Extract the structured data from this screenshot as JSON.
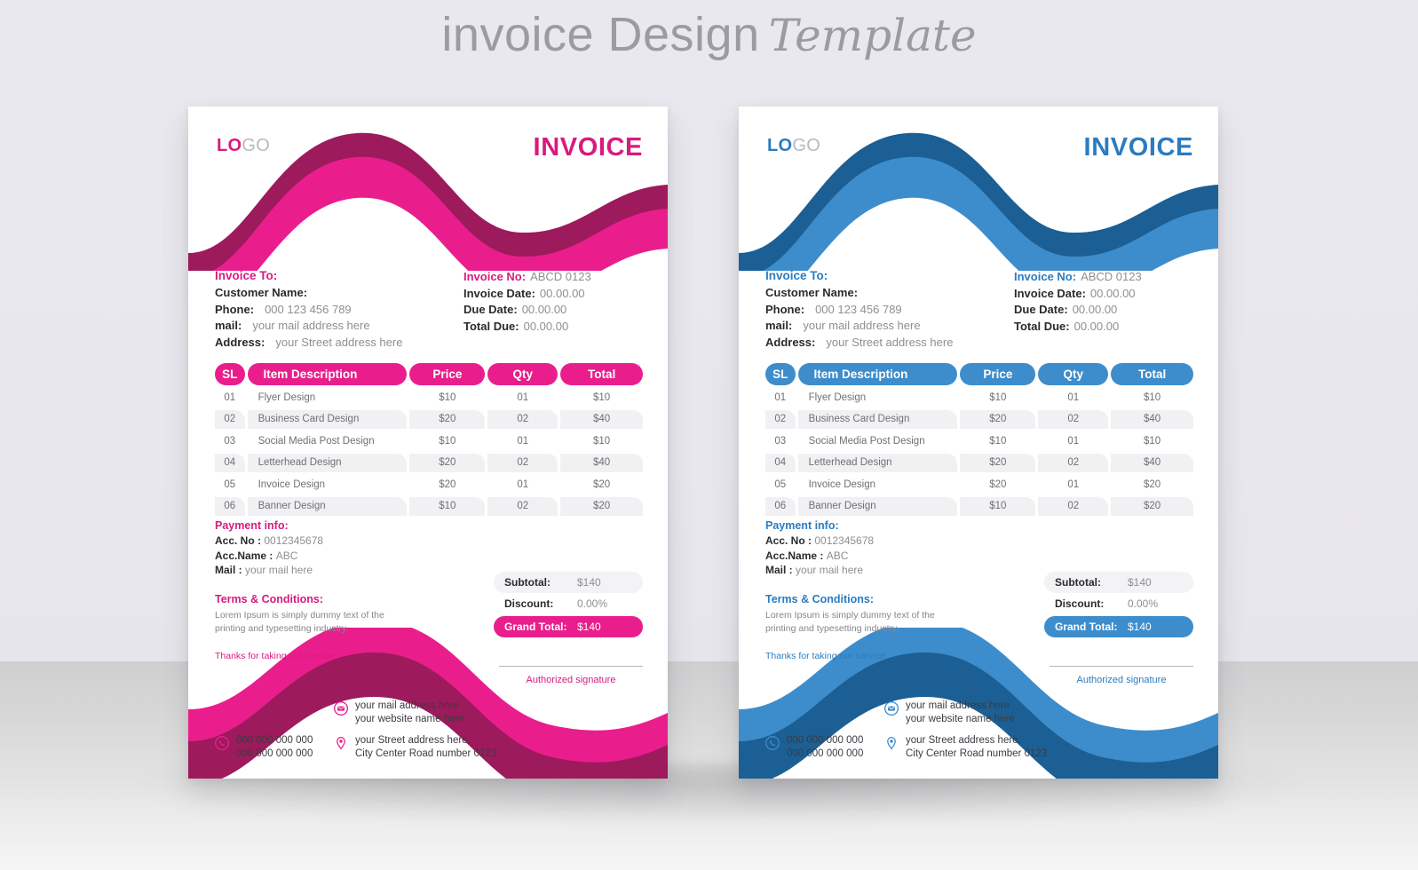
{
  "title": {
    "plain": "invoice Design",
    "script": "Template"
  },
  "theme": {
    "pink": {
      "dark": "#9d1a5c",
      "main": "#e91e8c",
      "accent": "#e91e8c",
      "title": "#d81b7e"
    },
    "blue": {
      "dark": "#1b5f94",
      "main": "#3d8dcc",
      "accent": "#3d8dcc",
      "title": "#2b7cc0"
    }
  },
  "invoice": {
    "logo": {
      "bold": "LO",
      "light": "GO"
    },
    "heading": "INVOICE",
    "bill_to": {
      "title": "Invoice To:",
      "rows": [
        {
          "label": "Customer Name:",
          "value": ""
        },
        {
          "label": "Phone:",
          "value": "000 123 456 789"
        },
        {
          "label": "mail:",
          "value": "your mail address here"
        },
        {
          "label": "Address:",
          "value": "your Street address here"
        }
      ]
    },
    "details": {
      "rows": [
        {
          "label": "Invoice No:",
          "value": "ABCD 0123"
        },
        {
          "label": "Invoice Date:",
          "value": "00.00.00"
        },
        {
          "label": "Due Date:",
          "value": "00.00.00"
        },
        {
          "label": "Total Due:",
          "value": "00.00.00"
        }
      ]
    },
    "table": {
      "columns": [
        "SL",
        "Item Description",
        "Price",
        "Qty",
        "Total"
      ],
      "rows": [
        {
          "sl": "01",
          "item": "Flyer Design",
          "price": "$10",
          "qty": "01",
          "total": "$10"
        },
        {
          "sl": "02",
          "item": "Business Card Design",
          "price": "$20",
          "qty": "02",
          "total": "$40"
        },
        {
          "sl": "03",
          "item": "Social Media Post Design",
          "price": "$10",
          "qty": "01",
          "total": "$10"
        },
        {
          "sl": "04",
          "item": "Letterhead Design",
          "price": "$20",
          "qty": "02",
          "total": "$40"
        },
        {
          "sl": "05",
          "item": "Invoice Design",
          "price": "$20",
          "qty": "01",
          "total": "$20"
        },
        {
          "sl": "06",
          "item": "Banner Design",
          "price": "$10",
          "qty": "02",
          "total": "$20"
        }
      ]
    },
    "payment": {
      "title": "Payment info:",
      "rows": [
        {
          "label": "Acc. No : ",
          "value": "0012345678"
        },
        {
          "label": "Acc.Name : ",
          "value": "ABC"
        },
        {
          "label": "Mail : ",
          "value": "your mail here"
        }
      ]
    },
    "terms": {
      "title": "Terms & Conditions:",
      "body": "Lorem Ipsum is simply dummy text of the printing and typesetting industry."
    },
    "thanks": "Thanks for taking our service",
    "totals": [
      {
        "label": "Subtotal:",
        "value": "$140"
      },
      {
        "label": "Discount:",
        "value": "0.00%"
      },
      {
        "label": "Grand Total:",
        "value": "$140"
      }
    ],
    "signature": "Authorized signature",
    "contacts": {
      "mail": {
        "line1": "your mail address here",
        "line2": "your website name here"
      },
      "phone": {
        "line1": "000 000 000 000",
        "line2": "000 000 000 000"
      },
      "address": {
        "line1": "your Street address here,",
        "line2": "City Center Road number 0123"
      }
    }
  }
}
